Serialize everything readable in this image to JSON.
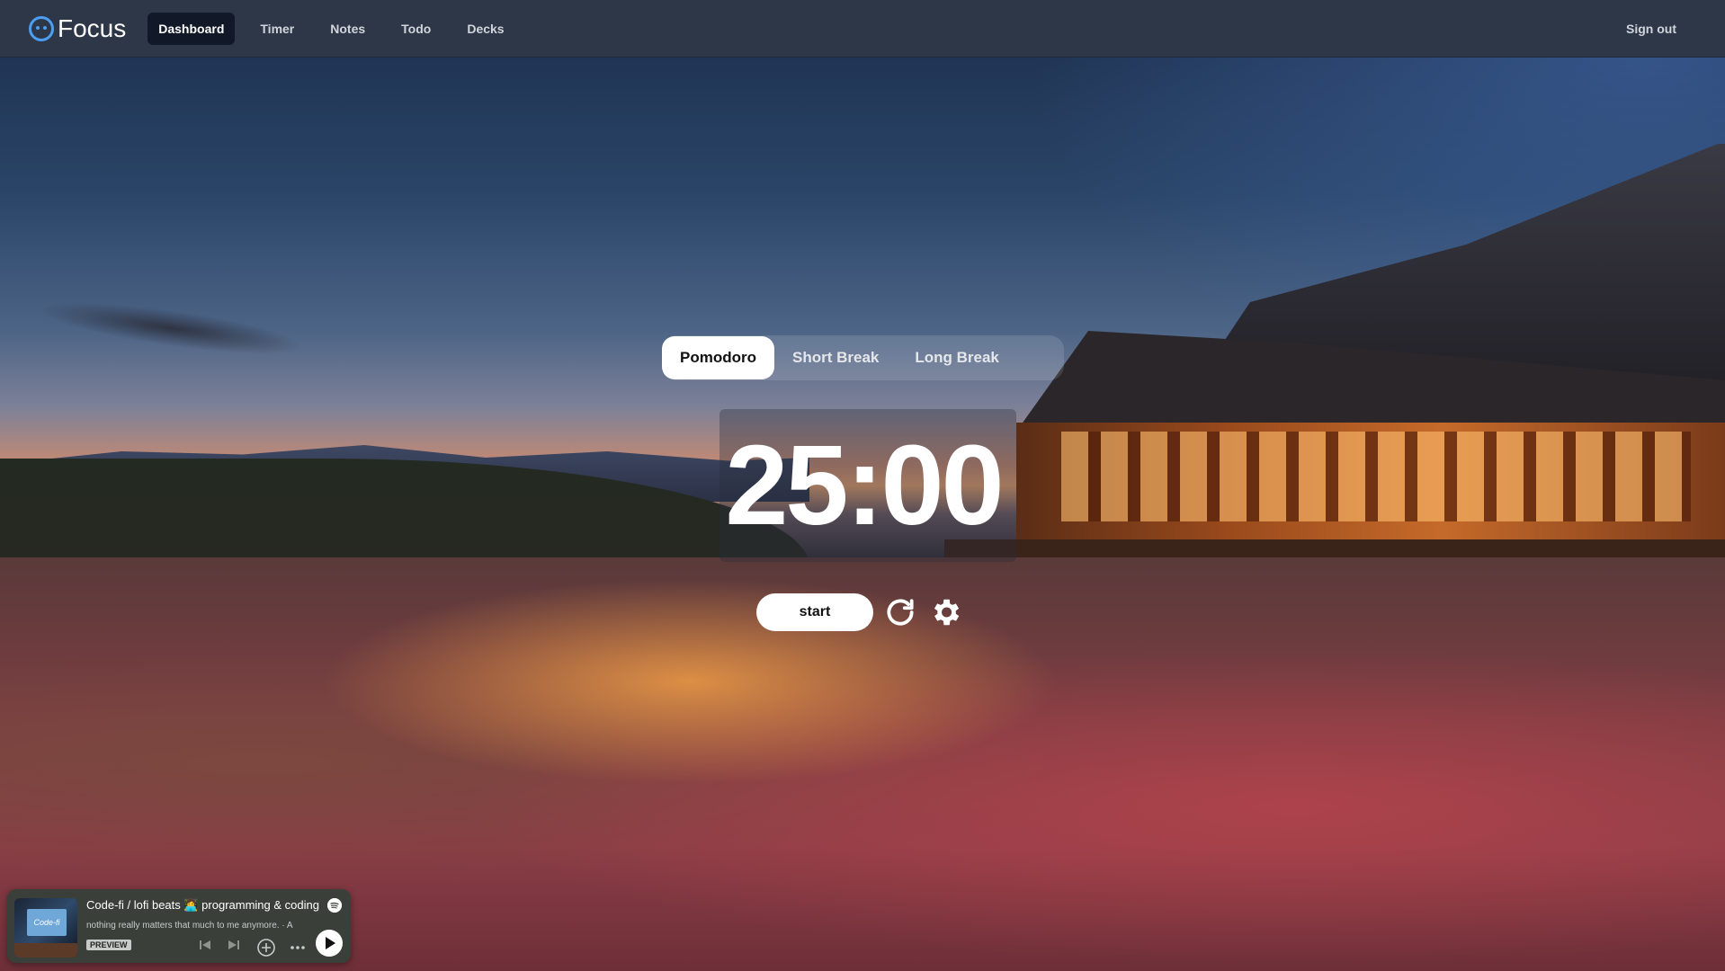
{
  "nav": {
    "brand": "Focus",
    "items": [
      {
        "label": "Dashboard",
        "active": true
      },
      {
        "label": "Timer",
        "active": false
      },
      {
        "label": "Notes",
        "active": false
      },
      {
        "label": "Todo",
        "active": false
      },
      {
        "label": "Decks",
        "active": false
      }
    ],
    "signout_label": "Sign out"
  },
  "timer": {
    "modes": [
      {
        "label": "Pomodoro",
        "active": true
      },
      {
        "label": "Short Break",
        "active": false
      },
      {
        "label": "Long Break",
        "active": false
      }
    ],
    "time": "25:00",
    "start_label": "start",
    "reset_icon": "refresh-icon",
    "settings_icon": "gear-icon"
  },
  "player": {
    "title": "Code-fi / lofi beats 👩‍💻 programming & coding",
    "subtitle": "nothing really matters that much to me anymore. · A",
    "badge": "PREVIEW",
    "art_text": "Code-fi",
    "icons": [
      "spotify-icon",
      "skip-back-icon",
      "skip-forward-icon",
      "add-icon",
      "more-icon",
      "play-icon"
    ]
  },
  "colors": {
    "navbar": "#2d3748",
    "nav_active": "#111827",
    "brand_accent": "#4c9ff0"
  }
}
